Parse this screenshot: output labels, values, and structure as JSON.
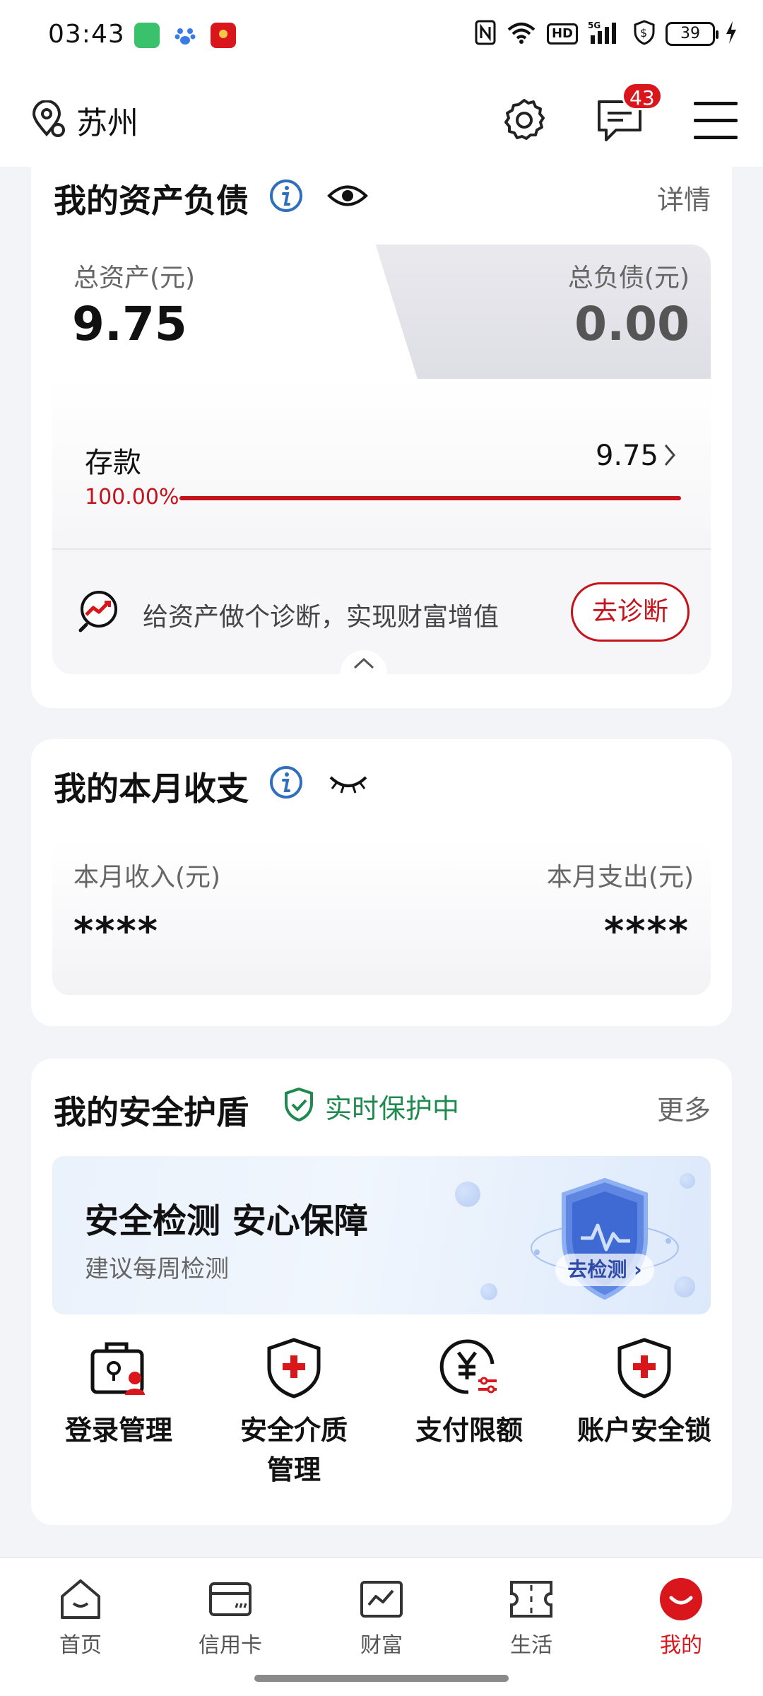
{
  "status_bar": {
    "time": "03:43",
    "battery": "39",
    "hd": "HD",
    "net": "5G"
  },
  "header": {
    "city": "苏州",
    "message_count": "43"
  },
  "assets": {
    "title": "我的资产负债",
    "detail_link": "详情",
    "total_assets_label": "总资产(元)",
    "total_assets_value": "9.75",
    "total_liabilities_label": "总负债(元)",
    "total_liabilities_value": "0.00",
    "deposit_label": "存款",
    "deposit_value": "9.75",
    "deposit_percent": "100.00%",
    "deposit_fraction": 1.0,
    "diagnosis_text": "给资产做个诊断，实现财富增值",
    "diagnosis_button": "去诊断"
  },
  "monthly": {
    "title": "我的本月收支",
    "income_label": "本月收入(元)",
    "income_value": "****",
    "expense_label": "本月支出(元)",
    "expense_value": "****"
  },
  "security": {
    "title": "我的安全护盾",
    "status": "实时保护中",
    "more_link": "更多",
    "banner_title": "安全检测 安心保障",
    "banner_subtitle": "建议每周检测",
    "banner_button": "去检测",
    "items": [
      {
        "label": "登录管理",
        "icon": "login-lock-icon"
      },
      {
        "label": "安全介质\n管理",
        "icon": "shield-plus-icon"
      },
      {
        "label": "支付限额",
        "icon": "yen-limit-icon"
      },
      {
        "label": "账户安全锁",
        "icon": "shield-lock-icon"
      }
    ]
  },
  "nav": [
    {
      "label": "首页",
      "icon": "home-icon"
    },
    {
      "label": "信用卡",
      "icon": "credit-card-icon"
    },
    {
      "label": "财富",
      "icon": "wealth-chart-icon"
    },
    {
      "label": "生活",
      "icon": "ticket-icon"
    },
    {
      "label": "我的",
      "icon": "profile-icon",
      "active": true
    }
  ],
  "colors": {
    "brand_red": "#d9161c",
    "deposit_red": "#c4131b",
    "protect_green": "#1f8a4f",
    "info_blue": "#2f6fbd"
  }
}
